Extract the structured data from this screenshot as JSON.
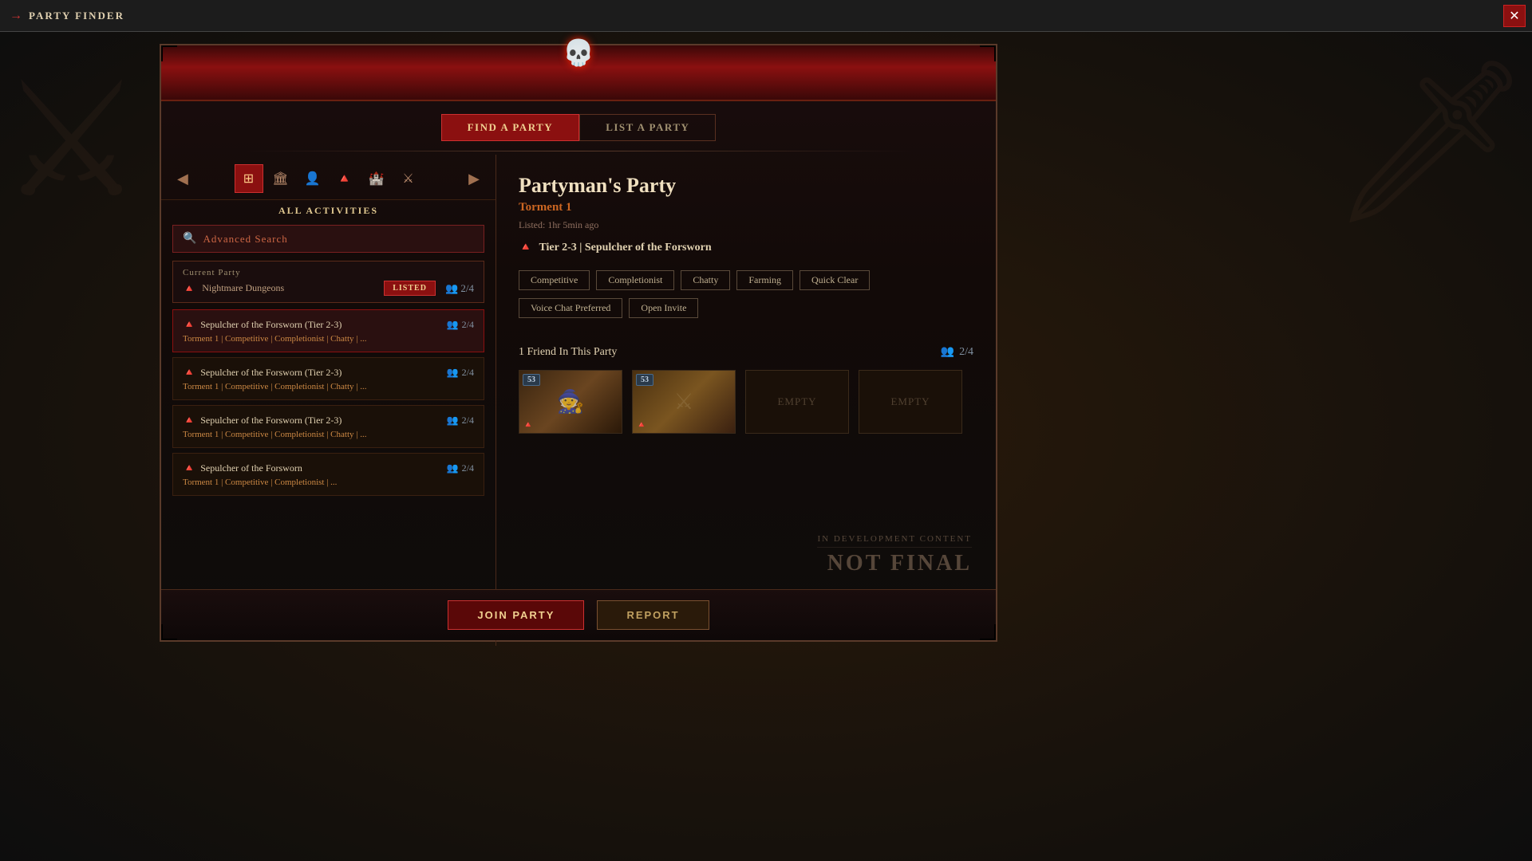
{
  "titleBar": {
    "icon": "→",
    "title": "PARTY FINDER",
    "closeLabel": "✕"
  },
  "tabs": [
    {
      "label": "FIND A PARTY",
      "active": true
    },
    {
      "label": "LIST A PARTY",
      "active": false
    }
  ],
  "leftPanel": {
    "allActivitiesLabel": "ALL ACTIVITIES",
    "searchPlaceholder": "Advanced Search",
    "filterIcons": [
      "⊞",
      "🏛",
      "👤",
      "🔥",
      "🏰",
      "⚔"
    ],
    "currentParty": {
      "label": "Current Party",
      "dungeonIcon": "🔺",
      "dungeonName": "Nightmare Dungeons",
      "badge": "LISTED",
      "memberCount": "2/4"
    },
    "partyList": [
      {
        "name": "Sepulcher of the Forsworn (Tier 2-3)",
        "memberCount": "2/4",
        "tags": "Torment 1  |  Competitive  |  Completionist  |  Chatty  |  ...",
        "selected": true
      },
      {
        "name": "Sepulcher of the Forsworn (Tier 2-3)",
        "memberCount": "2/4",
        "tags": "Torment 1  |  Competitive  |  Completionist  |  Chatty  |  ...",
        "selected": false
      },
      {
        "name": "Sepulcher of the Forsworn (Tier 2-3)",
        "memberCount": "2/4",
        "tags": "Torment 1  |  Competitive  |  Completionist  |  Chatty  |  ...",
        "selected": false
      },
      {
        "name": "Sepulcher of the Forsworn",
        "memberCount": "2/4",
        "tags": "Torment 1  |  Competitive  |  Completionist  |  ...",
        "selected": false
      }
    ]
  },
  "rightPanel": {
    "partyName": "Partyman's Party",
    "difficulty": "Torment 1",
    "listedTime": "Listed: 1hr 5min ago",
    "dungeonIcon": "🔺",
    "dungeonDetail": "Tier 2-3  |  Sepulcher of the Forsworn",
    "tags": [
      "Competitive",
      "Completionist",
      "Chatty",
      "Farming",
      "Quick Clear",
      "Voice Chat Preferred",
      "Open Invite"
    ],
    "friendsSection": {
      "label": "1 Friend In This Party",
      "memberCount": "2/4",
      "slots": [
        {
          "empty": false,
          "level": "53",
          "hasIcon": true
        },
        {
          "empty": false,
          "level": "53",
          "hasIcon": true
        },
        {
          "empty": true,
          "label": "EMPTY"
        },
        {
          "empty": true,
          "label": "EMPTY"
        }
      ]
    },
    "devWatermark": {
      "smallText": "IN DEVELOPMENT CONTENT",
      "largeText": "NOT FINAL"
    }
  },
  "bottomBar": {
    "joinLabel": "Join Party",
    "reportLabel": "Report"
  }
}
